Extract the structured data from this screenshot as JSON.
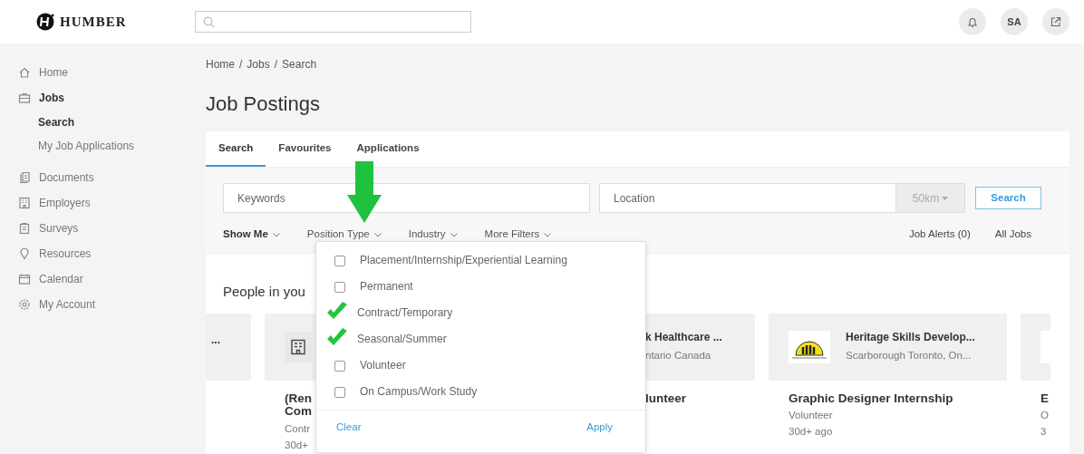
{
  "brand": {
    "name": "HUMBER"
  },
  "header": {
    "avatar": "SA"
  },
  "sidebar": {
    "items": [
      {
        "label": "Home",
        "selected": false
      },
      {
        "label": "Jobs",
        "selected": true,
        "children": [
          {
            "label": "Search",
            "selected": true
          },
          {
            "label": "My Job Applications",
            "selected": false
          }
        ]
      },
      {
        "label": "Documents",
        "selected": false
      },
      {
        "label": "Employers",
        "selected": false
      },
      {
        "label": "Surveys",
        "selected": false
      },
      {
        "label": "Resources",
        "selected": false
      },
      {
        "label": "Calendar",
        "selected": false
      },
      {
        "label": "My Account",
        "selected": false
      }
    ]
  },
  "breadcrumb": {
    "items": [
      "Home",
      "Jobs",
      "Search"
    ],
    "separator": "/"
  },
  "title": "Job Postings",
  "tabs": [
    {
      "label": "Search",
      "selected": true
    },
    {
      "label": "Favourites",
      "selected": false
    },
    {
      "label": "Applications",
      "selected": false
    }
  ],
  "search_form": {
    "keywords": {
      "placeholder": "Keywords"
    },
    "location": {
      "placeholder": "Location"
    },
    "radius": "50km",
    "button": "Search"
  },
  "filters": [
    {
      "label": "Show Me",
      "active": true
    },
    {
      "label": "Position Type",
      "active": false
    },
    {
      "label": "Industry",
      "active": false
    },
    {
      "label": "More Filters",
      "active": false
    }
  ],
  "links": [
    "Job Alerts (0)",
    "All Jobs"
  ],
  "section_heading": "People in you",
  "cards": [
    {
      "kind": "trailing",
      "company": "..."
    },
    {
      "kind": "narrow",
      "logo": {
        "kind": "building"
      },
      "title": "(Ren Com",
      "type": "Contr",
      "age": "30d+"
    },
    {
      "kind": "shifted",
      "company": "k Healthcare ...",
      "location": "ntario Canada",
      "title": "lunteer"
    },
    {
      "kind": "full",
      "logo": {
        "kind": "people"
      },
      "company": "Heritage Skills Develop...",
      "location": "Scarborough Toronto, On...",
      "title": "Graphic Designer Internship",
      "type": "Volunteer",
      "age": "30d+ ago"
    },
    {
      "kind": "full",
      "logo": {
        "kind": "blank"
      },
      "title": "E",
      "type": "O",
      "age": "3"
    }
  ],
  "position_type_menu": {
    "options": [
      {
        "label": "Placement/Internship/Experiential Learning",
        "checked": false
      },
      {
        "label": "Permanent",
        "checked": false
      },
      {
        "label": "Contract/Temporary",
        "checked": true
      },
      {
        "label": "Seasonal/Summer",
        "checked": true
      },
      {
        "label": "Volunteer",
        "checked": false
      },
      {
        "label": "On Campus/Work Study",
        "checked": false
      }
    ],
    "clear": "Clear",
    "apply": "Apply"
  },
  "annotation": {
    "kind": "arrow"
  }
}
